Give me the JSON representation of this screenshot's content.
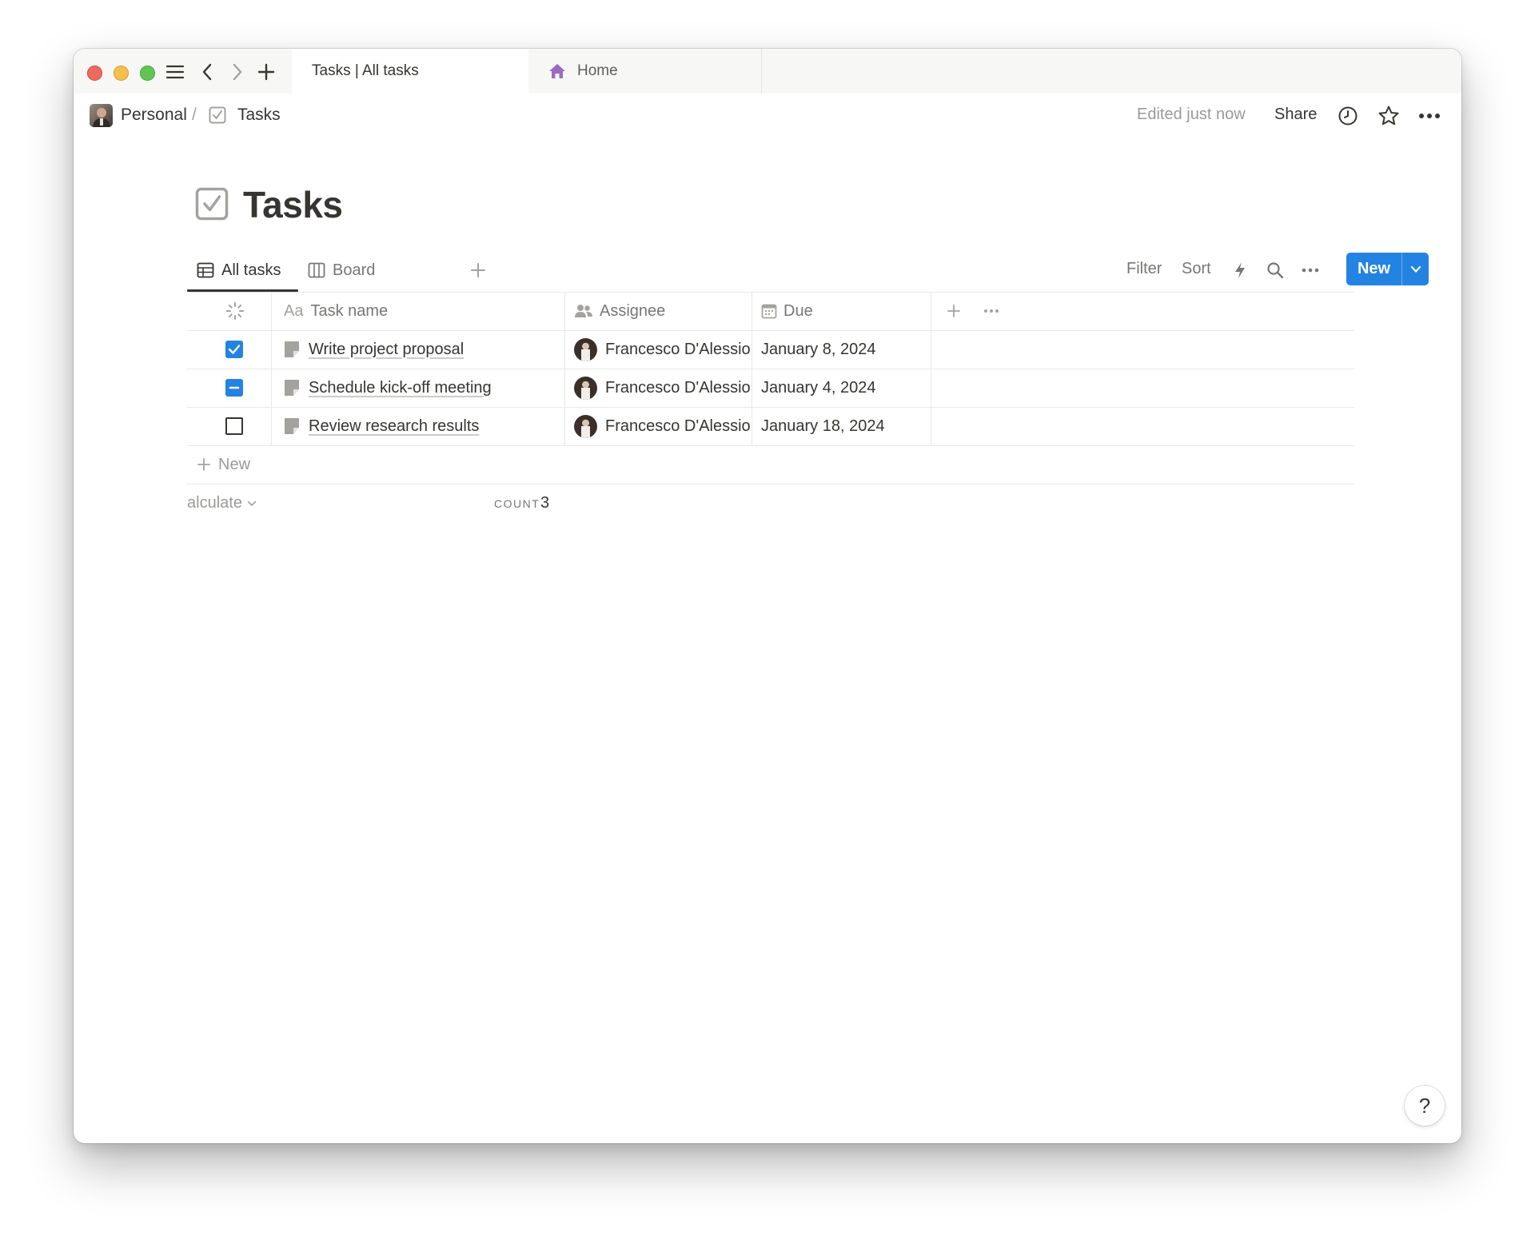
{
  "tabs": [
    {
      "label": "Tasks | All tasks",
      "active": true
    },
    {
      "label": "Home",
      "active": false
    }
  ],
  "breadcrumb": {
    "workspace": "Personal",
    "separator": "/",
    "page": "Tasks"
  },
  "topbar": {
    "edited": "Edited just now",
    "share": "Share"
  },
  "page": {
    "title": "Tasks"
  },
  "views": {
    "all_tasks": "All tasks",
    "board": "Board"
  },
  "toolbar": {
    "filter": "Filter",
    "sort": "Sort",
    "new": "New"
  },
  "table": {
    "columns": {
      "name_prefix": "Aa",
      "name": "Task name",
      "assignee": "Assignee",
      "due": "Due"
    },
    "rows": [
      {
        "status": "checked",
        "name": "Write project proposal",
        "assignee": "Francesco D'Alessio",
        "due": "January 8, 2024"
      },
      {
        "status": "partial",
        "name": "Schedule kick-off meeting",
        "assignee": "Francesco D'Alessio",
        "due": "January 4, 2024"
      },
      {
        "status": "empty",
        "name": "Review research results",
        "assignee": "Francesco D'Alessio",
        "due": "January 18, 2024"
      }
    ],
    "add_new": "New",
    "calculate": "alculate",
    "count_label": "COUNT",
    "count_value": "3"
  },
  "help": "?",
  "colors": {
    "accent": "#2383e2",
    "text": "#37352f",
    "muted": "#787774",
    "home_icon": "#9b6bc4"
  },
  "icons": {
    "hamburger": "menu-icon",
    "back": "chevron-left-icon",
    "forward": "chevron-right-icon",
    "new_tab": "plus-icon",
    "history": "clock-icon",
    "favorite": "star-icon",
    "more": "more-horizontal-icon"
  }
}
